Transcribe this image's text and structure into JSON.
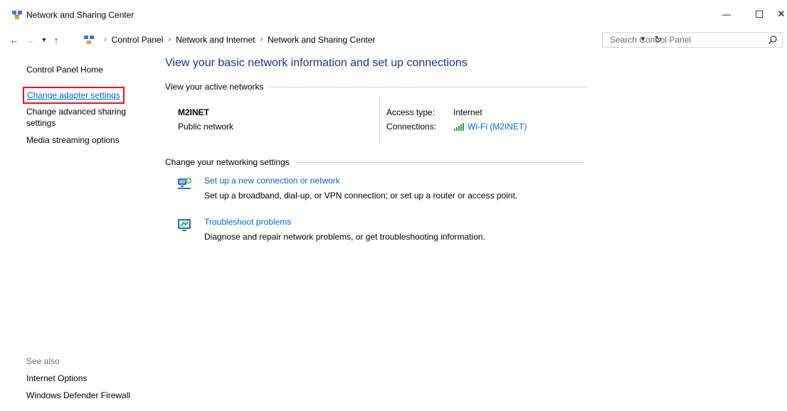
{
  "window": {
    "title": "Network and Sharing Center",
    "minimize_label": "—",
    "maximize_label": "☐",
    "close_label": "✕"
  },
  "icons": {
    "app": "network-center-icon",
    "back": "arrow-left-icon",
    "forward": "arrow-right-icon",
    "recent": "chevron-down-icon",
    "up": "arrow-up-icon",
    "refresh": "refresh-icon",
    "search": "search-icon",
    "wifi": "wifi-signal-icon",
    "new_connection": "new-connection-icon",
    "troubleshoot": "troubleshoot-icon"
  },
  "address": {
    "crumbs": [
      "Control Panel",
      "Network and Internet",
      "Network and Sharing Center"
    ]
  },
  "search": {
    "placeholder": "Search Control Panel"
  },
  "sidebar": {
    "home": "Control Panel Home",
    "items": [
      "Change adapter settings",
      "Change advanced sharing settings",
      "Media streaming options"
    ],
    "see_also_label": "See also",
    "see_also": [
      "Internet Options",
      "Windows Defender Firewall"
    ]
  },
  "main": {
    "heading": "View your basic network information and set up connections",
    "active_networks_title": "View your active networks",
    "network": {
      "name": "M2INET",
      "category": "Public network",
      "access_type_label": "Access type:",
      "access_type_value": "Internet",
      "connections_label": "Connections:",
      "connections_value": "Wi-Fi (M2INET)"
    },
    "change_title": "Change your networking settings",
    "tasks": [
      {
        "link": "Set up a new connection or network",
        "desc": "Set up a broadband, dial-up, or VPN connection; or set up a router or access point."
      },
      {
        "link": "Troubleshoot problems",
        "desc": "Diagnose and repair network problems, or get troubleshooting information."
      }
    ]
  },
  "colors": {
    "link": "#0066cc",
    "heading": "#1e3287",
    "highlight_box": "#e81123",
    "wifi_bars": "#2e9e3a"
  }
}
